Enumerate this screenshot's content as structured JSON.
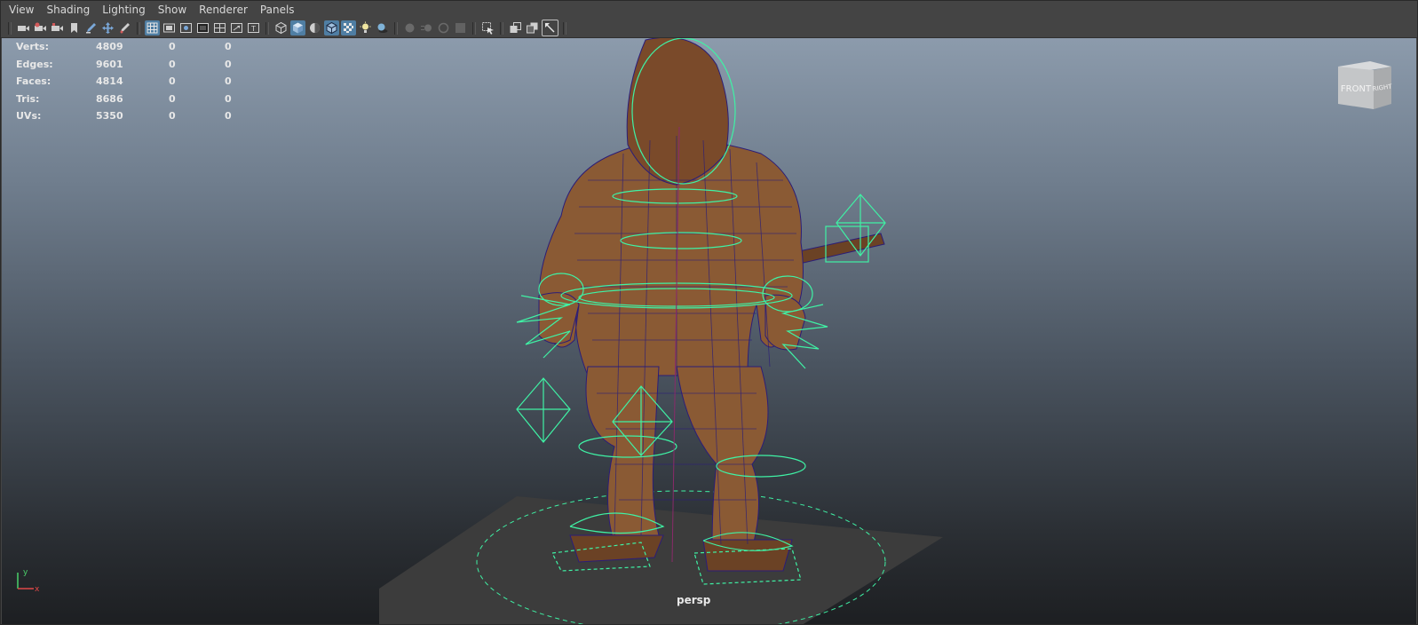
{
  "menubar": {
    "items": [
      "View",
      "Shading",
      "Lighting",
      "Show",
      "Renderer",
      "Panels"
    ]
  },
  "toolbar": {
    "groups": [
      [
        "camera-icon",
        "camera-attrs-icon",
        "bookmark-camera-icon",
        "bookmark-icon",
        "pencil-icon",
        "move-tool-icon",
        "grease-pencil-icon"
      ],
      [
        "grid-icon",
        "film-gate-icon",
        "resolution-gate-icon",
        "gate-mask-icon",
        "field-chart-icon",
        "safe-action-icon",
        "safe-title-icon"
      ],
      [
        "wireframe-icon",
        "smooth-shade-icon",
        "textured-icon",
        "wireframe-on-shaded-icon",
        "xray-icon",
        "use-lights-icon",
        "shadows-icon"
      ],
      [
        "ambient-occlusion-icon",
        "motion-blur-icon",
        "anti-alias-icon",
        "depth-of-field-icon"
      ],
      [
        "isolate-select-icon",
        "xray-joints-icon",
        "xray-active-icon",
        "maximize-icon"
      ]
    ],
    "active": [
      "grid-icon",
      "smooth-shade-icon",
      "wireframe-on-shaded-icon",
      "xray-icon"
    ]
  },
  "hud": {
    "rows": [
      {
        "label": "Verts:",
        "v1": "4809",
        "v2": "0",
        "v3": "0"
      },
      {
        "label": "Edges:",
        "v1": "9601",
        "v2": "0",
        "v3": "0"
      },
      {
        "label": "Faces:",
        "v1": "4814",
        "v2": "0",
        "v3": "0"
      },
      {
        "label": "Tris:",
        "v1": "8686",
        "v2": "0",
        "v3": "0"
      },
      {
        "label": "UVs:",
        "v1": "5350",
        "v2": "0",
        "v3": "0"
      }
    ]
  },
  "viewcube": {
    "front": "FRONT",
    "right": "RIGHT"
  },
  "camera_label": "persp",
  "axis": {
    "y": "y",
    "x": "x"
  },
  "colors": {
    "menubar_bg": "#444444",
    "viewport_top": "#8c9bac",
    "viewport_bottom": "#1d1f22",
    "control_curves": "#3ff2a5",
    "mesh_skin": "#8a5a34",
    "wireframe": "#2b1d78",
    "active_toolbar": "#4f7ea3"
  }
}
